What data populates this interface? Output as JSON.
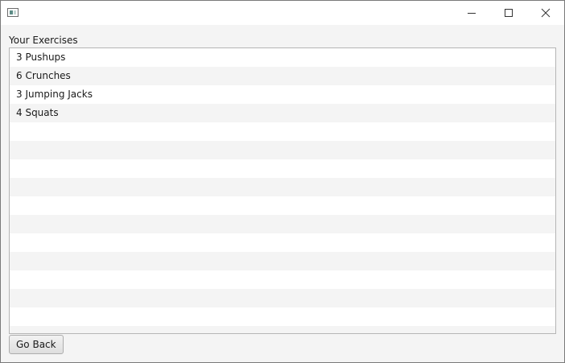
{
  "window": {
    "icon": "app-window-icon",
    "controls": {
      "minimize_icon": "minimize-icon",
      "maximize_icon": "maximize-icon",
      "close_icon": "close-icon"
    }
  },
  "exercises": {
    "label": "Your Exercises",
    "items": [
      "3 Pushups",
      "6 Crunches",
      "3 Jumping Jacks",
      "4 Squats",
      "",
      "",
      "",
      "",
      "",
      "",
      "",
      "",
      "",
      "",
      "",
      ""
    ]
  },
  "footer": {
    "go_back_label": "Go Back"
  }
}
